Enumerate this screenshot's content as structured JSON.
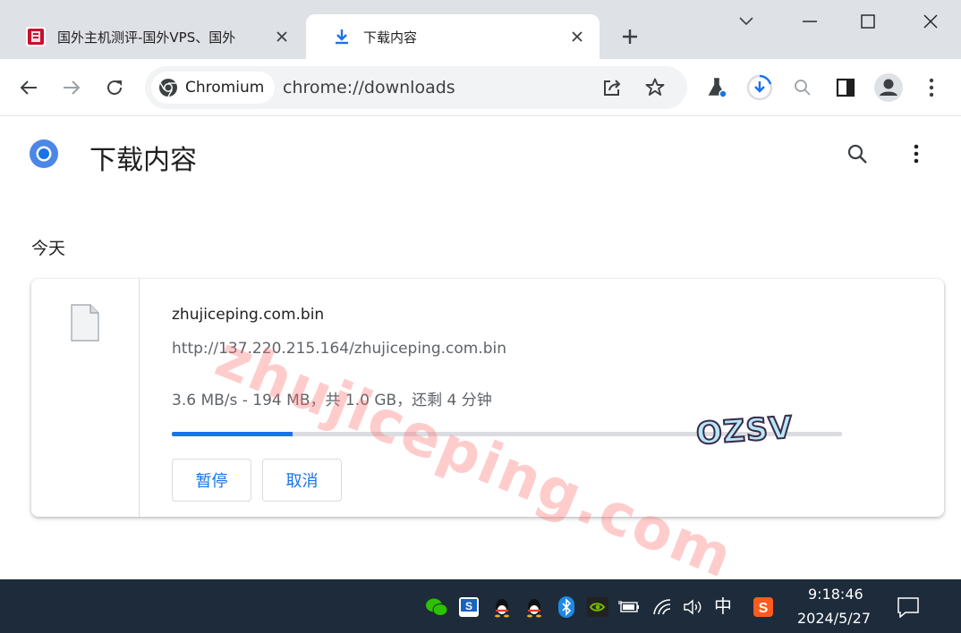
{
  "tabs": [
    {
      "title": "国外主机测评-国外VPS、国外",
      "favicon": "site-favicon",
      "active": false
    },
    {
      "title": "下载内容",
      "favicon": "download-icon",
      "active": true
    }
  ],
  "omnibox": {
    "chip_label": "Chromium",
    "url": "chrome://downloads"
  },
  "page": {
    "title": "下载内容",
    "section_date": "今天"
  },
  "download": {
    "filename": "zhujiceping.com.bin",
    "url": "http://137.220.215.164/zhujiceping.com.bin",
    "status": "3.6 MB/s - 194 MB，共 1.0 GB，还剩 4 分钟",
    "progress_fraction": 0.18,
    "pause_label": "暂停",
    "cancel_label": "取消"
  },
  "watermark": {
    "text": "zhujiceping.com",
    "logo": "OZSV"
  },
  "taskbar": {
    "ime": "中",
    "time": "9:18:46",
    "date": "2024/5/27"
  },
  "colors": {
    "accent": "#1a73e8",
    "tabstrip": "#dee1e6",
    "taskbar": "#1d2b3a"
  }
}
